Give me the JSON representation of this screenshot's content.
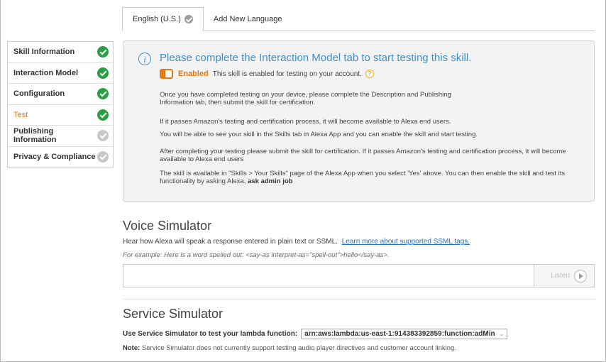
{
  "tabs": {
    "active_label": "English (U.S.)",
    "add_label": "Add New Language"
  },
  "sidebar": {
    "items": [
      {
        "label": "Skill Information",
        "status": "complete"
      },
      {
        "label": "Interaction Model",
        "status": "complete"
      },
      {
        "label": "Configuration",
        "status": "complete"
      },
      {
        "label": "Test",
        "status": "complete",
        "current": true
      },
      {
        "label": "Publishing Information",
        "status": "incomplete"
      },
      {
        "label": "Privacy & Compliance",
        "status": "incomplete"
      }
    ]
  },
  "info": {
    "title": "Please complete the Interaction Model tab to start testing this skill.",
    "enabled_label": "Enabled",
    "enabled_text": "This skill is enabled for testing on your account.",
    "help_glyph": "?",
    "para1": "Once you have completed testing on your device, please complete the Description and Publishing Information tab, then submit the skill for certification.",
    "para2": "If it passes Amazon's testing and certification process, it will become available to Alexa end users.",
    "para3": "You will be able to see your skill in the Skills tab in Alexa App and you can enable the skill and start testing.",
    "para4": "After completing your testing please submit the skill for certification. If it passes Amazon's testing and certification process, it will become available to Alexa end users",
    "para5": "The skill is available in \"Skills > Your Skills\" page of the Alexa App when you select 'Yes' above. You can then enable the skill and test its functionality by asking Alexa,",
    "para5_bold": "ask admin job"
  },
  "voice": {
    "heading": "Voice Simulator",
    "description": "Hear how Alexa will speak a response entered in plain text or SSML.",
    "link": "Learn more about supported SSML tags.",
    "example": "For example: Here is a word spelled out: <say-as interpret-as=\"spell-out\">hello</say-as>.",
    "input_value": "",
    "listen_label": "Listen"
  },
  "service": {
    "heading": "Service Simulator",
    "label": "Use Service Simulator to test your lambda function:",
    "selected_function": "arn:aws:lambda:us-east-1:914383392859:function:adMin",
    "note_label": "Note:",
    "note_text": "Service Simulator does not currently support testing audio player directives and customer account linking."
  },
  "colors": {
    "accent": "#e47911",
    "success": "#2a9e42",
    "info_blue": "#3d91c9"
  }
}
